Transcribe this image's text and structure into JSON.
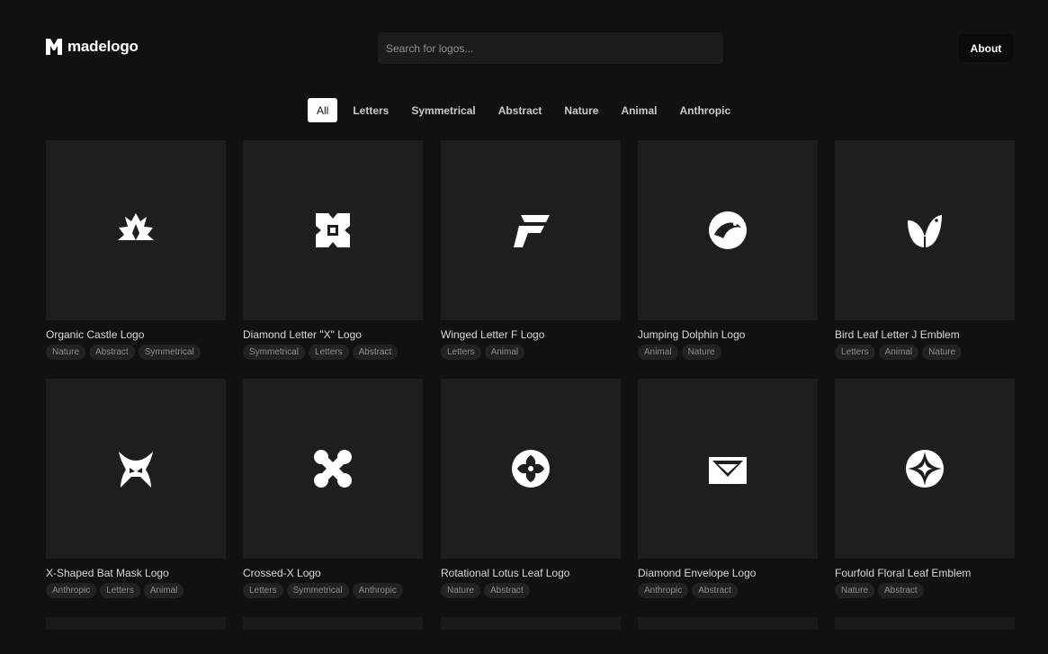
{
  "header": {
    "brand_name": "madelogo",
    "search_placeholder": "Search for logos...",
    "about_label": "About"
  },
  "filters": [
    "All",
    "Letters",
    "Symmetrical",
    "Abstract",
    "Nature",
    "Animal",
    "Anthropic"
  ],
  "active_filter": "All",
  "colors": {
    "background": "#111111",
    "card": "#1e1e1e",
    "active_tab": "#ffffff"
  },
  "logos": [
    {
      "title": "Organic Castle Logo",
      "tags": [
        "Nature",
        "Abstract",
        "Symmetrical"
      ],
      "icon": "organic-castle-icon"
    },
    {
      "title": "Diamond Letter \"X\" Logo",
      "tags": [
        "Symmetrical",
        "Letters",
        "Abstract"
      ],
      "icon": "diamond-x-icon"
    },
    {
      "title": "Winged Letter F Logo",
      "tags": [
        "Letters",
        "Animal"
      ],
      "icon": "winged-f-icon"
    },
    {
      "title": "Jumping Dolphin Logo",
      "tags": [
        "Animal",
        "Nature"
      ],
      "icon": "dolphin-icon"
    },
    {
      "title": "Bird Leaf Letter J Emblem",
      "tags": [
        "Letters",
        "Animal",
        "Nature"
      ],
      "icon": "bird-leaf-icon"
    },
    {
      "title": "X-Shaped Bat Mask Logo",
      "tags": [
        "Anthropic",
        "Letters",
        "Animal"
      ],
      "icon": "bat-mask-icon"
    },
    {
      "title": "Crossed-X Logo",
      "tags": [
        "Letters",
        "Symmetrical",
        "Anthropic"
      ],
      "icon": "crossed-x-icon"
    },
    {
      "title": "Rotational Lotus Leaf Logo",
      "tags": [
        "Nature",
        "Abstract"
      ],
      "icon": "lotus-icon"
    },
    {
      "title": "Diamond Envelope Logo",
      "tags": [
        "Anthropic",
        "Abstract"
      ],
      "icon": "envelope-icon"
    },
    {
      "title": "Fourfold Floral Leaf Emblem",
      "tags": [
        "Nature",
        "Abstract"
      ],
      "icon": "floral-icon"
    }
  ]
}
